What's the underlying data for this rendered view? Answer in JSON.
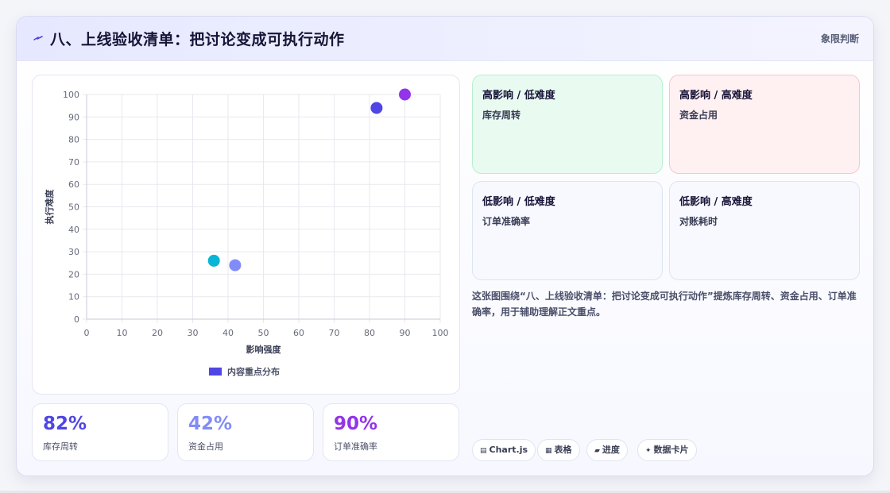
{
  "header": {
    "title": "八、上线验收清单：把讨论变成可执行动作",
    "right_label": "象限判断",
    "icon": "lightning-icon"
  },
  "chart_data": {
    "type": "scatter",
    "xlabel": "影响强度",
    "ylabel": "执行难度",
    "xlim": [
      0,
      100
    ],
    "ylim": [
      0,
      100
    ],
    "x_ticks": [
      0,
      10,
      20,
      30,
      40,
      50,
      60,
      70,
      80,
      90,
      100
    ],
    "y_ticks": [
      0,
      10,
      20,
      30,
      40,
      50,
      60,
      70,
      80,
      90,
      100
    ],
    "grid": true,
    "legend_position": "bottom",
    "series": [
      {
        "name": "内容重点分布",
        "color": "#4f46e5",
        "points": [
          {
            "x": 36,
            "y": 26,
            "color": "#06b6d4"
          },
          {
            "x": 42,
            "y": 24,
            "color": "#818cf8"
          },
          {
            "x": 82,
            "y": 94,
            "color": "#4f46e5"
          },
          {
            "x": 90,
            "y": 100,
            "color": "#9333ea"
          }
        ]
      }
    ]
  },
  "stats": [
    {
      "value": "82%",
      "label": "库存周转",
      "color": "#4f46e5"
    },
    {
      "value": "42%",
      "label": "资金占用",
      "color": "#818cf8"
    },
    {
      "value": "90%",
      "label": "订单准确率",
      "color": "#9333ea"
    }
  ],
  "quadrants": [
    {
      "title": "高影响 / 低难度",
      "item": "库存周转"
    },
    {
      "title": "高影响 / 高难度",
      "item": "资金占用"
    },
    {
      "title": "低影响 / 低难度",
      "item": "订单准确率"
    },
    {
      "title": "低影响 / 高难度",
      "item": "对账耗时"
    }
  ],
  "description": "这张图围绕“八、上线验收清单：把讨论变成可执行动作”提炼库存周转、资金占用、订单准确率，用于辅助理解正文重点。",
  "tags": [
    {
      "icon": "chart-icon",
      "glyph": "▤",
      "label": "Chart.js"
    },
    {
      "icon": "table-icon",
      "glyph": "▦",
      "label": "表格"
    },
    {
      "icon": "progress-icon",
      "glyph": "▰",
      "label": "进度"
    },
    {
      "icon": "sparkle-icon",
      "glyph": "✦",
      "label": "数据卡片"
    }
  ]
}
